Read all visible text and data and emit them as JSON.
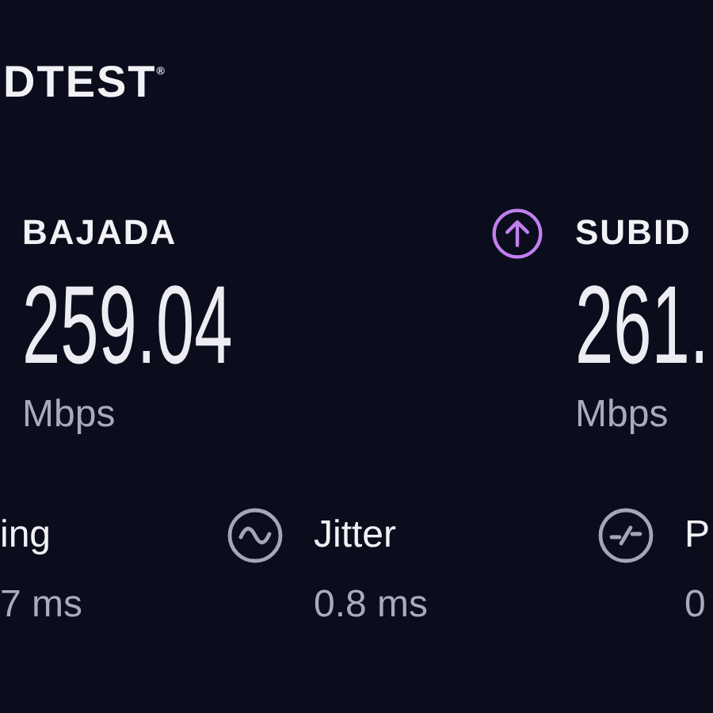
{
  "logo": "DTEST$^{®}$",
  "speeds": [
    {
      "kind": "download",
      "label": "BAJADA",
      "value": "259.04",
      "unit": "Mbps"
    },
    {
      "kind": "upload",
      "label": "SUBID",
      "value": "261.",
      "unit": "Mbps"
    }
  ],
  "stats": [
    {
      "kind": "ping",
      "label": "ing",
      "value": "7 ms"
    },
    {
      "kind": "jitter",
      "label": "Jitter",
      "value": "0.8 ms"
    },
    {
      "kind": "packet-loss",
      "label": "P",
      "value": "0"
    }
  ]
}
